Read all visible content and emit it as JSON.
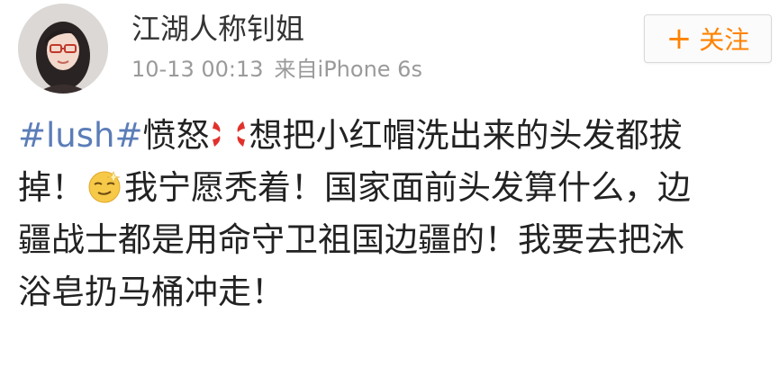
{
  "author": {
    "name": "江湖人称钊姐"
  },
  "meta": {
    "time": "10-13 00:13",
    "source": "来自iPhone 6s"
  },
  "follow_button": {
    "plus": "+",
    "label": "关注",
    "color": "#ff8200"
  },
  "post": {
    "hashtag": "#lush#",
    "line1_text": "愤怒",
    "line1_rest": "想把小红帽洗出来的头发都拔",
    "line2_start": "掉！",
    "line2_rest": "我宁愿秃着！国家面前头发算什么，边",
    "line3": "疆战士都是用命守卫祖国边疆的！我要去把沐",
    "line4": "浴皂扔马桶冲走！"
  },
  "icons": {
    "anger": "anger-emoji-icon",
    "smile": "smug-emoji-icon"
  },
  "colors": {
    "hashtag": "#5b7db8",
    "meta": "#9a9a9a",
    "text": "#222222"
  }
}
